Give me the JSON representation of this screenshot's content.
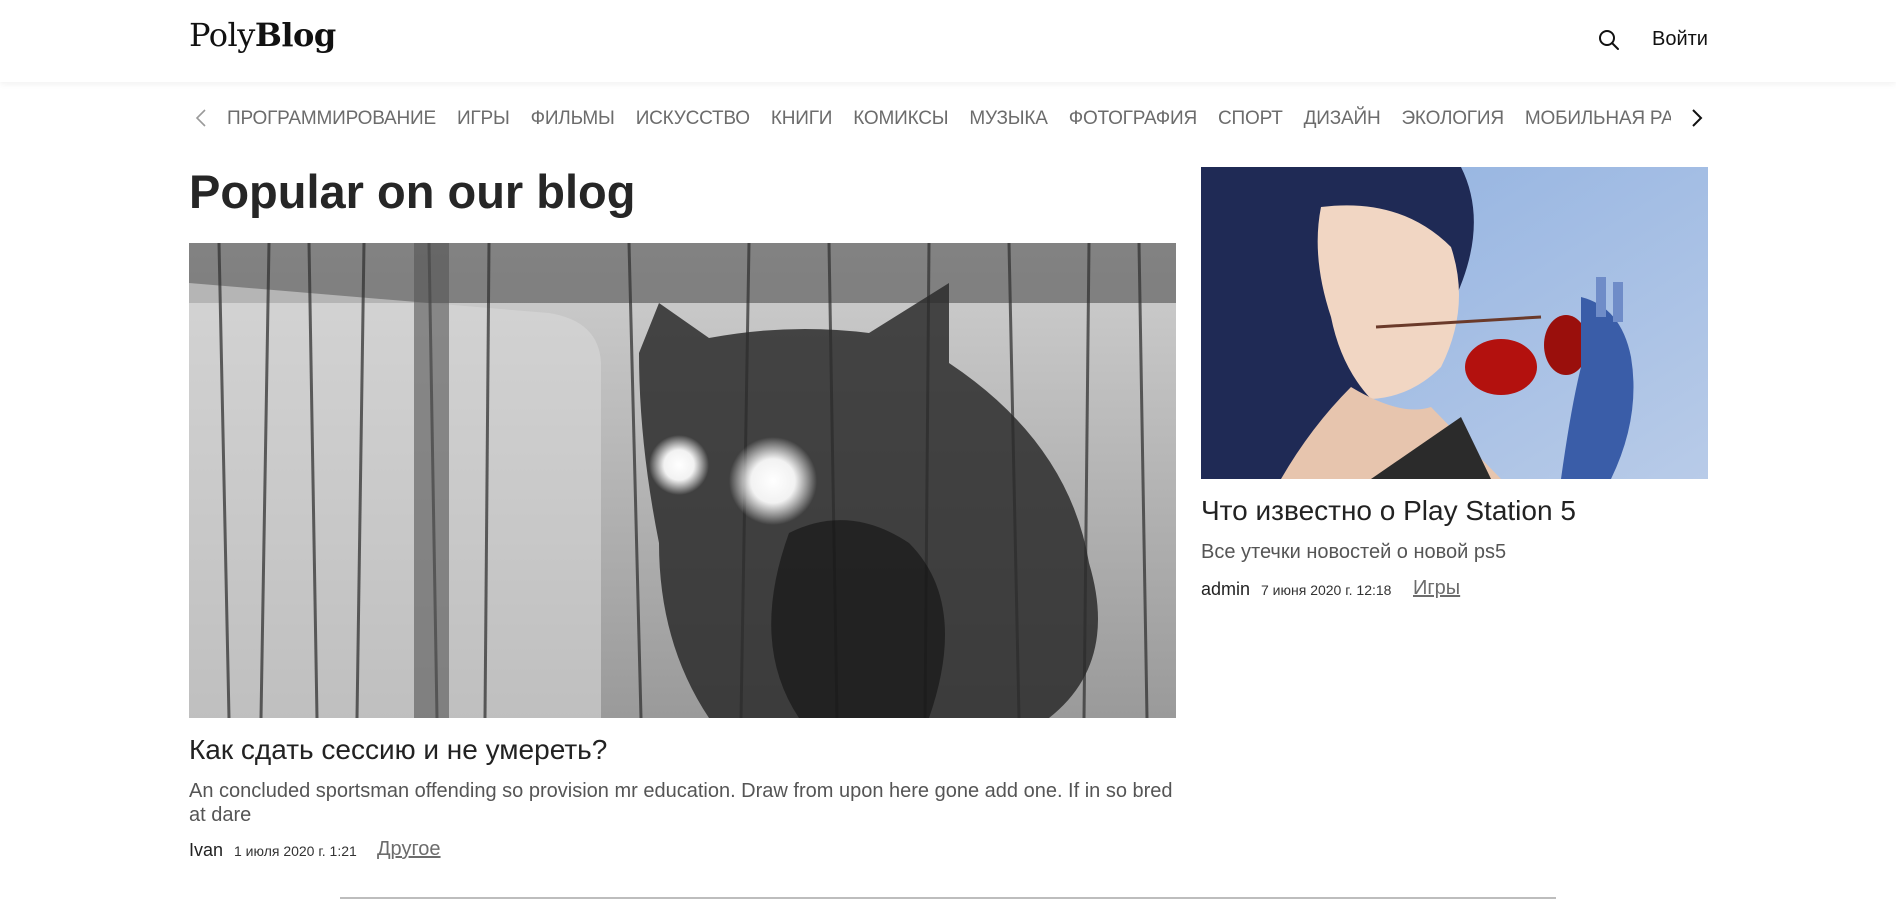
{
  "header": {
    "logo_light": "Poly",
    "logo_bold": "Blog",
    "login_label": "Войти",
    "search_icon": "search-icon"
  },
  "categories": [
    "ПРОГРАММИРОВАНИЕ",
    "ИГРЫ",
    "ФИЛЬМЫ",
    "ИСКУССТВО",
    "КНИГИ",
    "КОМИКСЫ",
    "МУЗЫКА",
    "ФОТОГРАФИЯ",
    "СПОРТ",
    "ДИЗАЙН",
    "ЭКОЛОГИЯ",
    "МОБИЛЬНАЯ РАЗРА"
  ],
  "page": {
    "title": "Popular on our blog"
  },
  "posts": [
    {
      "title": "Как сдать сессию и не умереть?",
      "excerpt": "An concluded sportsman offending so provision mr education. Draw from upon here gone add one. If in so bred at dare",
      "author": "Ivan",
      "date": "1 июля 2020 г. 1:21",
      "category": "Другое"
    },
    {
      "title": "Что известно о Play Station 5",
      "excerpt": "Все утечки новостей о новой ps5",
      "author": "admin",
      "date": "7 июня 2020 г. 12:18",
      "category": "Игры"
    }
  ]
}
